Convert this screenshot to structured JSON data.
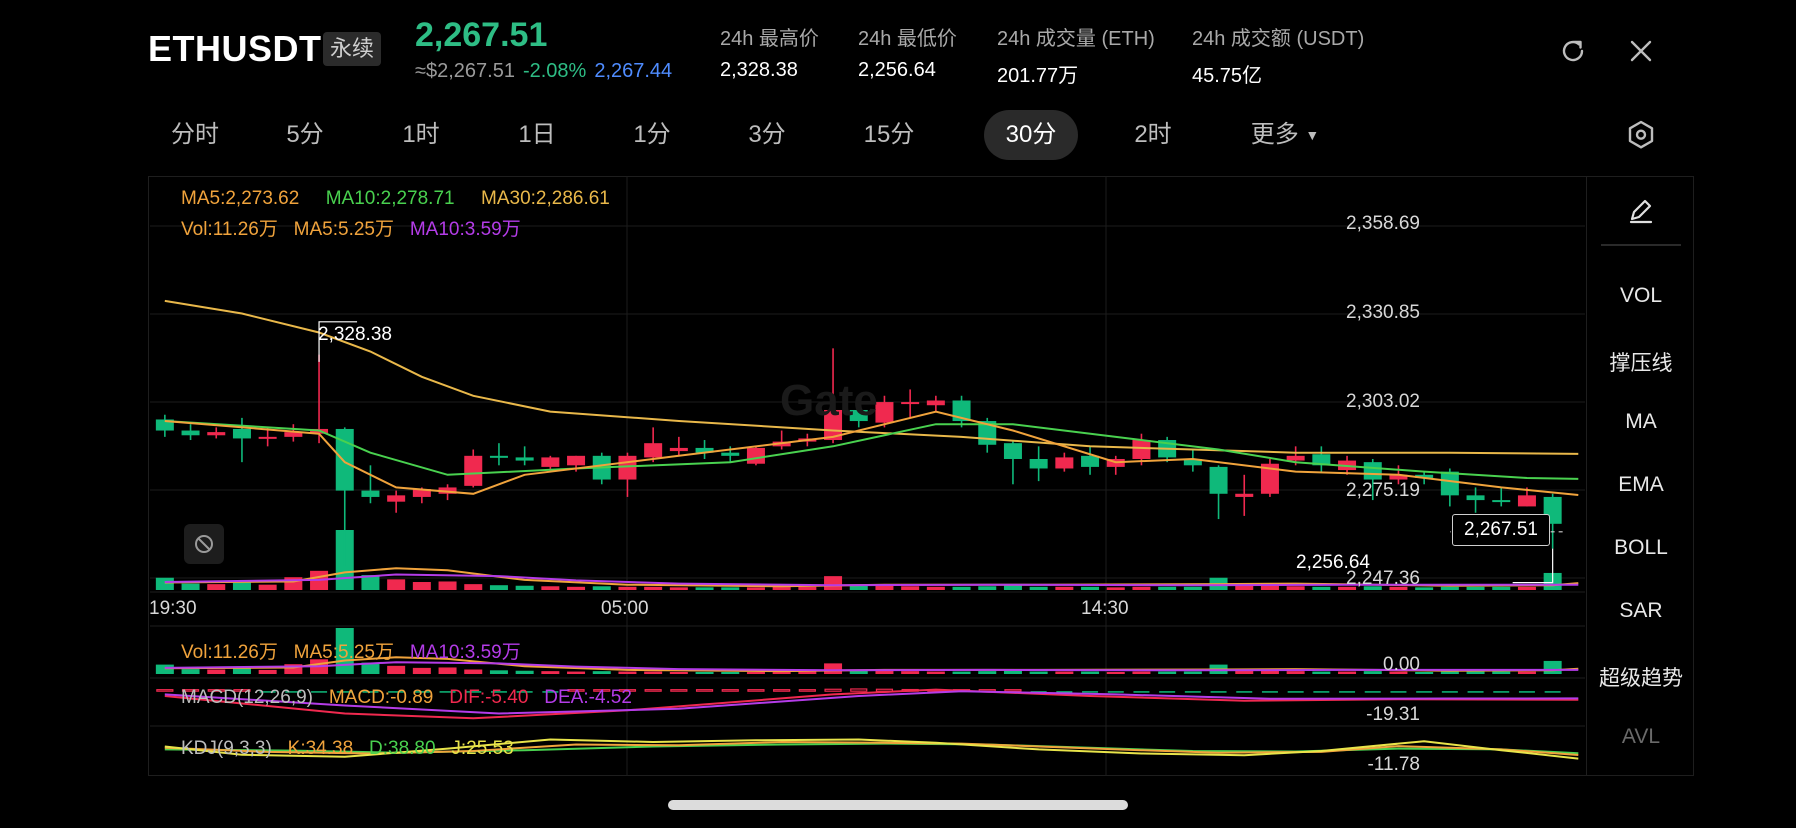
{
  "header": {
    "symbol": "ETHUSDT",
    "badge": "永续",
    "price": "2,267.51",
    "approx": "≈$2,267.51",
    "change": "-2.08%",
    "mark": "2,267.44",
    "stats": [
      {
        "label": "24h 最高价",
        "value": "2,328.38"
      },
      {
        "label": "24h 最低价",
        "value": "2,256.64"
      },
      {
        "label": "24h 成交量 (ETH)",
        "value": "201.77万"
      },
      {
        "label": "24h 成交额 (USDT)",
        "value": "45.75亿"
      }
    ]
  },
  "tabs": [
    "分时",
    "5分",
    "1时",
    "1日",
    "1分",
    "3分",
    "15分",
    "30分",
    "2时",
    "更多"
  ],
  "active_tab": "30分",
  "sidebar": [
    "VOL",
    "撑压线",
    "MA",
    "EMA",
    "BOLL",
    "SAR",
    "超级趋势",
    "AVL"
  ],
  "legends": {
    "ma5": "MA5:2,273.62",
    "ma10": "MA10:2,278.71",
    "ma30": "MA30:2,286.61",
    "vol": "Vol:11.26万",
    "vma5": "MA5:5.25万",
    "vma10": "MA10:3.59万",
    "macd_name": "MACD(12,26,9)",
    "macd": "MACD:-0.89",
    "dif": "DIF:-5.40",
    "dea": "DEA:-4.52",
    "kdj_name": "KDJ(9,3,3)",
    "k": "K:34.38",
    "d": "D:38.80",
    "j": "J:25.53"
  },
  "watermark": "Gate",
  "colors": {
    "up": "#f0294f",
    "down": "#0fb97a",
    "ma5": "#f0a33c",
    "ma10": "#49d14f",
    "ma30": "#e9b84a",
    "vma10": "#b43ce8",
    "kdj_j": "#e8e44a"
  },
  "chart_data": {
    "type": "candlestick",
    "interval": "30分",
    "ylim": [
      2247.36,
      2358.69
    ],
    "yticks": [
      "2,358.69",
      "2,330.85",
      "2,303.02",
      "2,275.19",
      "2,247.36"
    ],
    "xticks": [
      "19:30",
      "05:00",
      "14:30"
    ],
    "current_price": "2,267.51",
    "high_label": "2,328.38",
    "low_label": "2,256.64",
    "candles": [
      {
        "o": 2297.5,
        "h": 2299,
        "c": 2294,
        "l": 2292
      },
      {
        "o": 2294,
        "h": 2296,
        "c": 2292.5,
        "l": 2291
      },
      {
        "o": 2292.5,
        "h": 2295,
        "c": 2293.5,
        "l": 2291.5
      },
      {
        "o": 2294.5,
        "h": 2298,
        "c": 2291.5,
        "l": 2284
      },
      {
        "o": 2291.5,
        "h": 2295,
        "c": 2292,
        "l": 2289
      },
      {
        "o": 2292,
        "h": 2296,
        "c": 2293.5,
        "l": 2290.5
      },
      {
        "o": 2293,
        "h": 2318,
        "c": 2294.5,
        "l": 2290
      },
      {
        "o": 2294.5,
        "h": 2295,
        "c": 2275,
        "l": 2251
      },
      {
        "o": 2275,
        "h": 2283,
        "c": 2273,
        "l": 2271
      },
      {
        "o": 2271.5,
        "h": 2275,
        "c": 2273.5,
        "l": 2268
      },
      {
        "o": 2273,
        "h": 2276,
        "c": 2275.5,
        "l": 2271
      },
      {
        "o": 2274,
        "h": 2277,
        "c": 2276,
        "l": 2272
      },
      {
        "o": 2276.5,
        "h": 2288,
        "c": 2286,
        "l": 2276
      },
      {
        "o": 2286,
        "h": 2290,
        "c": 2285.5,
        "l": 2283
      },
      {
        "o": 2285.5,
        "h": 2289,
        "c": 2284.5,
        "l": 2283
      },
      {
        "o": 2282.5,
        "h": 2286,
        "c": 2285.5,
        "l": 2281
      },
      {
        "o": 2283,
        "h": 2286,
        "c": 2286,
        "l": 2281
      },
      {
        "o": 2286,
        "h": 2287,
        "c": 2278.5,
        "l": 2277
      },
      {
        "o": 2278.5,
        "h": 2287,
        "c": 2286,
        "l": 2273
      },
      {
        "o": 2285.5,
        "h": 2295,
        "c": 2290,
        "l": 2284
      },
      {
        "o": 2287.5,
        "h": 2292,
        "c": 2288.5,
        "l": 2286
      },
      {
        "o": 2288.5,
        "h": 2291,
        "c": 2287,
        "l": 2285
      },
      {
        "o": 2287,
        "h": 2289,
        "c": 2286,
        "l": 2284
      },
      {
        "o": 2283.5,
        "h": 2289,
        "c": 2288.5,
        "l": 2283
      },
      {
        "o": 2289,
        "h": 2294,
        "c": 2290.5,
        "l": 2288
      },
      {
        "o": 2290.5,
        "h": 2293,
        "c": 2291.5,
        "l": 2289
      },
      {
        "o": 2291,
        "h": 2320,
        "c": 2300.5,
        "l": 2290
      },
      {
        "o": 2300.5,
        "h": 2304,
        "c": 2297,
        "l": 2295
      },
      {
        "o": 2296.5,
        "h": 2305,
        "c": 2303,
        "l": 2295
      },
      {
        "o": 2303,
        "h": 2307,
        "c": 2303,
        "l": 2298
      },
      {
        "o": 2302,
        "h": 2305,
        "c": 2303.5,
        "l": 2300
      },
      {
        "o": 2303.5,
        "h": 2305,
        "c": 2297,
        "l": 2295
      },
      {
        "o": 2297,
        "h": 2298,
        "c": 2289.5,
        "l": 2287
      },
      {
        "o": 2290,
        "h": 2291,
        "c": 2285,
        "l": 2277
      },
      {
        "o": 2285,
        "h": 2289,
        "c": 2282,
        "l": 2278
      },
      {
        "o": 2282,
        "h": 2287,
        "c": 2285.5,
        "l": 2281
      },
      {
        "o": 2286,
        "h": 2289,
        "c": 2282.5,
        "l": 2280
      },
      {
        "o": 2282.5,
        "h": 2286,
        "c": 2285,
        "l": 2280
      },
      {
        "o": 2285,
        "h": 2293,
        "c": 2291,
        "l": 2283
      },
      {
        "o": 2291,
        "h": 2292,
        "c": 2285.5,
        "l": 2284
      },
      {
        "o": 2285,
        "h": 2288,
        "c": 2283,
        "l": 2281
      },
      {
        "o": 2282.5,
        "h": 2283,
        "c": 2274,
        "l": 2266
      },
      {
        "o": 2273,
        "h": 2280,
        "c": 2274,
        "l": 2267
      },
      {
        "o": 2274,
        "h": 2285,
        "c": 2283.5,
        "l": 2273
      },
      {
        "o": 2284.5,
        "h": 2289,
        "c": 2286,
        "l": 2283
      },
      {
        "o": 2286.5,
        "h": 2289,
        "c": 2283,
        "l": 2281
      },
      {
        "o": 2281.5,
        "h": 2286,
        "c": 2284.5,
        "l": 2280
      },
      {
        "o": 2284,
        "h": 2285,
        "c": 2278.5,
        "l": 2272
      },
      {
        "o": 2278.5,
        "h": 2283,
        "c": 2280,
        "l": 2277
      },
      {
        "o": 2280,
        "h": 2281,
        "c": 2279,
        "l": 2277
      },
      {
        "o": 2281,
        "h": 2282,
        "c": 2273.5,
        "l": 2270
      },
      {
        "o": 2273.5,
        "h": 2276,
        "c": 2272,
        "l": 2268
      },
      {
        "o": 2272,
        "h": 2276,
        "c": 2271.5,
        "l": 2270
      },
      {
        "o": 2270,
        "h": 2276,
        "c": 2273.5,
        "l": 2270
      },
      {
        "o": 2273,
        "h": 2274,
        "c": 2264.5,
        "l": 2256.64
      }
    ],
    "ma5": [
      [
        0,
        2297
      ],
      [
        6,
        2293
      ],
      [
        7,
        2284
      ],
      [
        9,
        2276
      ],
      [
        12,
        2274
      ],
      [
        14,
        2280
      ],
      [
        20,
        2286
      ],
      [
        26,
        2292
      ],
      [
        30,
        2300
      ],
      [
        33,
        2294
      ],
      [
        37,
        2284
      ],
      [
        40,
        2285
      ],
      [
        44,
        2281
      ],
      [
        48,
        2280
      ],
      [
        52,
        2276
      ],
      [
        55,
        2273.6
      ]
    ],
    "ma10": [
      [
        0,
        2297
      ],
      [
        6,
        2294
      ],
      [
        8,
        2287
      ],
      [
        11,
        2280
      ],
      [
        16,
        2282
      ],
      [
        22,
        2284
      ],
      [
        26,
        2289
      ],
      [
        30,
        2296
      ],
      [
        33,
        2296
      ],
      [
        38,
        2291
      ],
      [
        41,
        2288
      ],
      [
        44,
        2284
      ],
      [
        49,
        2281
      ],
      [
        53,
        2279
      ],
      [
        55,
        2278.7
      ]
    ],
    "ma30": [
      [
        0,
        2335
      ],
      [
        3,
        2331
      ],
      [
        6,
        2325
      ],
      [
        8,
        2319
      ],
      [
        10,
        2311
      ],
      [
        12,
        2305
      ],
      [
        15,
        2300
      ],
      [
        20,
        2297
      ],
      [
        26,
        2294
      ],
      [
        31,
        2292
      ],
      [
        36,
        2289
      ],
      [
        40,
        2288
      ],
      [
        44,
        2287
      ],
      [
        50,
        2287
      ],
      [
        55,
        2286.6
      ]
    ],
    "volume_ylim": [
      0,
      11.26
    ],
    "volume": [
      2.3,
      1.2,
      1.1,
      1.4,
      1.0,
      2.4,
      3.6,
      11.26,
      2.8,
      2.0,
      1.5,
      1.6,
      1.1,
      0.9,
      0.8,
      0.7,
      0.6,
      0.7,
      0.6,
      0.6,
      0.5,
      0.5,
      0.5,
      0.5,
      0.6,
      0.6,
      2.6,
      0.8,
      0.8,
      0.7,
      0.6,
      0.6,
      0.7,
      0.9,
      0.6,
      0.6,
      0.6,
      0.5,
      0.6,
      0.6,
      0.6,
      2.3,
      0.9,
      0.8,
      0.7,
      0.6,
      0.6,
      0.7,
      0.6,
      0.5,
      0.6,
      0.6,
      0.6,
      0.6,
      3.2
    ],
    "vol_ma5": [
      [
        0,
        1.4
      ],
      [
        5,
        1.6
      ],
      [
        7,
        3.3
      ],
      [
        9,
        4.1
      ],
      [
        11,
        3.7
      ],
      [
        14,
        1.9
      ],
      [
        18,
        1.0
      ],
      [
        24,
        0.7
      ],
      [
        28,
        1.0
      ],
      [
        34,
        1.0
      ],
      [
        41,
        1.1
      ],
      [
        44,
        1.2
      ],
      [
        50,
        0.8
      ],
      [
        54,
        0.9
      ],
      [
        55,
        1.3
      ]
    ],
    "vol_ma10": [
      [
        0,
        1.5
      ],
      [
        6,
        1.9
      ],
      [
        9,
        2.9
      ],
      [
        13,
        2.6
      ],
      [
        16,
        1.8
      ],
      [
        20,
        1.2
      ],
      [
        26,
        0.9
      ],
      [
        32,
        1.0
      ],
      [
        40,
        0.9
      ],
      [
        46,
        1.0
      ],
      [
        55,
        1.0
      ]
    ],
    "macd_hist": [
      0.2,
      0.1,
      0.1,
      0.0,
      -0.1,
      -0.1,
      -0.2,
      -0.8,
      -1.2,
      -1.3,
      -1.1,
      -0.9,
      -0.6,
      -0.3,
      -0.2,
      -0.1,
      0.0,
      0.1,
      0.2,
      0.3,
      0.5,
      0.7,
      0.9,
      1.1,
      1.3,
      1.5,
      2.0,
      2.3,
      2.0,
      1.7,
      1.3,
      0.9,
      0.6,
      0.2,
      -0.1,
      -0.3,
      -0.4,
      -0.5,
      -0.4,
      -0.3,
      -0.4,
      -0.6,
      -0.8,
      -0.6,
      -0.4,
      -0.3,
      -0.3,
      -0.4,
      -0.5,
      -0.5,
      -0.6,
      -0.7,
      -0.7,
      -0.8,
      -0.89
    ],
    "macd_ylim": [
      -19.31,
      7
    ],
    "dif": [
      [
        0,
        -3
      ],
      [
        7,
        -14
      ],
      [
        12,
        -17
      ],
      [
        18,
        -12
      ],
      [
        26,
        -2
      ],
      [
        30,
        1
      ],
      [
        36,
        -3
      ],
      [
        42,
        -6
      ],
      [
        48,
        -5
      ],
      [
        55,
        -5.4
      ]
    ],
    "dea": [
      [
        0,
        -2
      ],
      [
        7,
        -9
      ],
      [
        13,
        -14
      ],
      [
        20,
        -11
      ],
      [
        27,
        -3
      ],
      [
        31,
        0
      ],
      [
        37,
        -2
      ],
      [
        43,
        -4.8
      ],
      [
        50,
        -4.6
      ],
      [
        55,
        -4.52
      ]
    ],
    "kdj_ylim": [
      -11.78,
      100
    ],
    "kdj_k": [
      [
        0,
        52
      ],
      [
        4,
        42
      ],
      [
        8,
        38
      ],
      [
        12,
        44
      ],
      [
        16,
        60
      ],
      [
        20,
        58
      ],
      [
        24,
        66
      ],
      [
        28,
        64
      ],
      [
        31,
        62
      ],
      [
        34,
        55
      ],
      [
        38,
        46
      ],
      [
        41,
        40
      ],
      [
        45,
        42
      ],
      [
        48,
        56
      ],
      [
        52,
        48
      ],
      [
        55,
        34.38
      ]
    ],
    "kdj_d": [
      [
        0,
        48
      ],
      [
        5,
        45
      ],
      [
        9,
        40
      ],
      [
        14,
        46
      ],
      [
        19,
        55
      ],
      [
        24,
        60
      ],
      [
        28,
        62
      ],
      [
        32,
        60
      ],
      [
        36,
        52
      ],
      [
        40,
        44
      ],
      [
        44,
        43
      ],
      [
        48,
        50
      ],
      [
        52,
        48
      ],
      [
        55,
        38.8
      ]
    ],
    "kdj_j": [
      [
        0,
        55
      ],
      [
        3,
        35
      ],
      [
        7,
        30
      ],
      [
        11,
        50
      ],
      [
        15,
        72
      ],
      [
        19,
        66
      ],
      [
        23,
        70
      ],
      [
        27,
        72
      ],
      [
        30,
        64
      ],
      [
        34,
        48
      ],
      [
        38,
        38
      ],
      [
        42,
        34
      ],
      [
        45,
        44
      ],
      [
        49,
        68
      ],
      [
        52,
        46
      ],
      [
        55,
        25.53
      ]
    ]
  }
}
